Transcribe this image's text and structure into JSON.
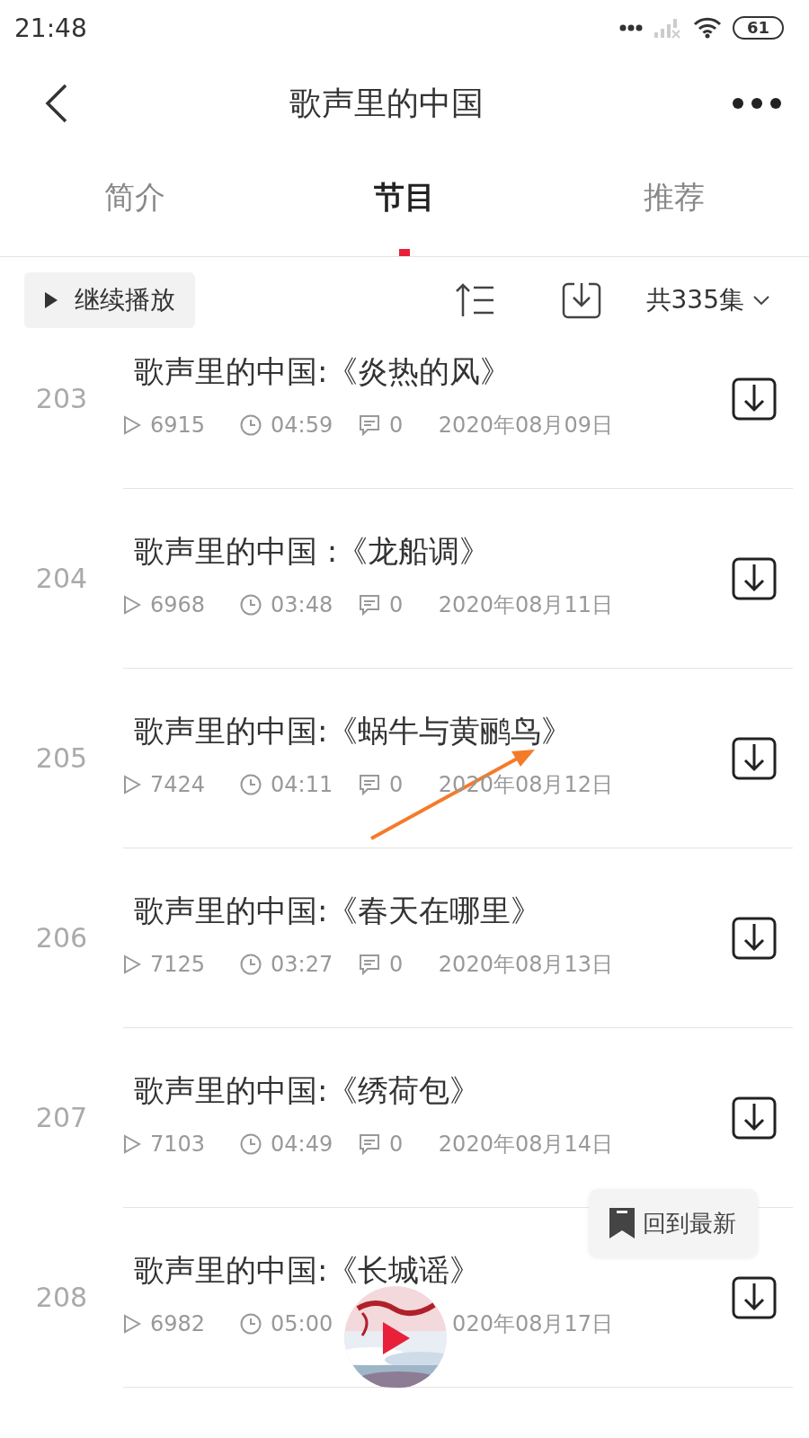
{
  "status_bar": {
    "time": "21:48",
    "battery": "61"
  },
  "header": {
    "title": "歌声里的中国"
  },
  "tabs": [
    {
      "label": "简介",
      "selected": false
    },
    {
      "label": "节目",
      "selected": true
    },
    {
      "label": "推荐",
      "selected": false
    }
  ],
  "toolbar": {
    "continue_button": "继续播放",
    "episode_count": "共335集"
  },
  "episodes": [
    {
      "number": "203",
      "title": "歌声里的中国:《炎热的风》",
      "plays": "6915",
      "duration": "04:59",
      "comments": "0",
      "date": "2020年08月09日"
    },
    {
      "number": "204",
      "title": "歌声里的中国 :《龙船调》",
      "plays": "6968",
      "duration": "03:48",
      "comments": "0",
      "date": "2020年08月11日"
    },
    {
      "number": "205",
      "title": "歌声里的中国:《蜗牛与黄鹂鸟》",
      "plays": "7424",
      "duration": "04:11",
      "comments": "0",
      "date": "2020年08月12日"
    },
    {
      "number": "206",
      "title": "歌声里的中国:《春天在哪里》",
      "plays": "7125",
      "duration": "03:27",
      "comments": "0",
      "date": "2020年08月13日"
    },
    {
      "number": "207",
      "title": "歌声里的中国:《绣荷包》",
      "plays": "7103",
      "duration": "04:49",
      "comments": "0",
      "date": "2020年08月14日"
    },
    {
      "number": "208",
      "title": "歌声里的中国:《长城谣》",
      "plays": "6982",
      "duration": "05:00",
      "date": "020年08月17日"
    }
  ],
  "back_to_latest": "回到最新"
}
